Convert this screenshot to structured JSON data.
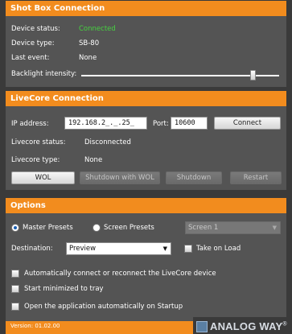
{
  "shot_box": {
    "title": "Shot Box Connection",
    "device_status_label": "Device status:",
    "device_status_value": "Connected",
    "device_type_label": "Device type:",
    "device_type_value": "SB-80",
    "last_event_label": "Last event:",
    "last_event_value": "None",
    "backlight_label": "Backlight intensity:",
    "backlight_level_fraction": 0.88
  },
  "livecore": {
    "title": "LiveCore Connection",
    "ip_label": "IP address:",
    "ip_value": "192.168.2_._.25_",
    "port_label": "Port:",
    "port_value": "10600",
    "connect_label": "Connect",
    "status_label": "Livecore status:",
    "status_value": "Disconnected",
    "type_label": "Livecore type:",
    "type_value": "None",
    "wol_label": "WOL",
    "shutdown_wol_label": "Shutdown with WOL",
    "shutdown_label": "Shutdown",
    "restart_label": "Restart"
  },
  "options": {
    "title": "Options",
    "master_presets_label": "Master Presets",
    "screen_presets_label": "Screen Presets",
    "screen_select_value": "Screen 1",
    "destination_label": "Destination:",
    "destination_value": "Preview",
    "take_on_load_label": "Take on Load",
    "auto_connect_label": "Automatically connect or reconnect the LiveCore device",
    "start_minimized_label": "Start minimized to tray",
    "open_startup_label": "Open the application automatically on Startup"
  },
  "footer": {
    "version": "Version: 01.02.00",
    "brand": "ANALOG WAY",
    "brand_mark": "®"
  },
  "colors": {
    "accent": "#f28c1e",
    "panel": "#545454",
    "background": "#3a3a3a",
    "connected": "#46d140"
  },
  "icons": {
    "dropdown": "chevron-down-icon",
    "logo": "analog-way-logo-icon"
  }
}
